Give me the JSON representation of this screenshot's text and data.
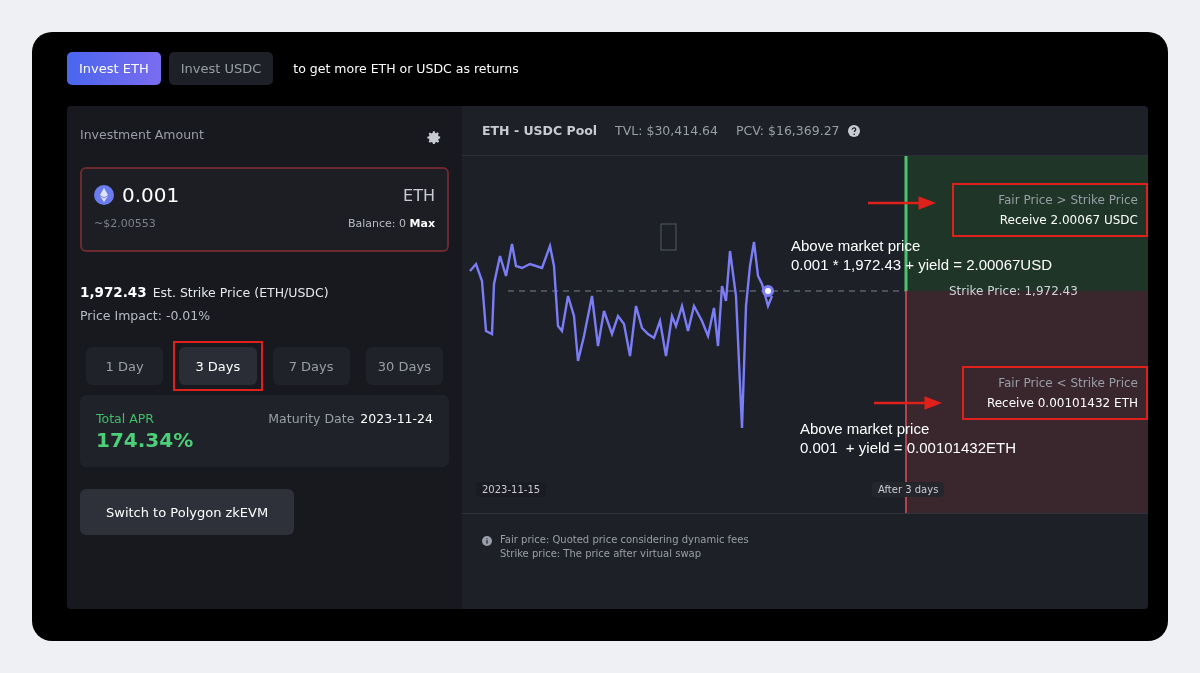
{
  "tabs": [
    {
      "label": "Invest ETH",
      "selected": true
    },
    {
      "label": "Invest USDC",
      "selected": false
    }
  ],
  "tagline": "to get more ETH or USDC as returns",
  "investment": {
    "label": "Investment Amount",
    "amount": "0.001",
    "unit": "ETH",
    "usd": "~$2.00553",
    "balance": "Balance: 0",
    "max": "Max"
  },
  "strike": {
    "value": "1,972.43",
    "label": "Est. Strike Price (ETH/USDC)",
    "impact": "Price Impact: -0.01%"
  },
  "durations": [
    {
      "label": "1 Day",
      "selected": false,
      "annotated": false
    },
    {
      "label": "3 Days",
      "selected": true,
      "annotated": true
    },
    {
      "label": "7 Days",
      "selected": false,
      "annotated": false
    },
    {
      "label": "30 Days",
      "selected": false,
      "annotated": false
    }
  ],
  "apr": {
    "label": "Total APR",
    "value": "174.34%",
    "maturity_label": "Maturity Date",
    "maturity": "2023-11-24"
  },
  "switch_button": "Switch to Polygon zkEVM",
  "pool": {
    "name": "ETH - USDC Pool",
    "tvl": "TVL: $30,414.64",
    "pcv": "PCV: $16,369.27"
  },
  "chart": {
    "strike_label": "Strike Price: 1,972.43",
    "start_date": "2023-11-15",
    "end_label": "After 3 days",
    "outcomes": [
      {
        "kind": "above",
        "condition": "Fair Price > Strike Price",
        "receive": "Receive 2.00067 USDC",
        "annotated": true
      },
      {
        "kind": "below",
        "condition": "Fair Price < Strike Price",
        "receive": "Receive 0.00101432 ETH",
        "annotated": true
      }
    ],
    "notes": [
      {
        "kind": "above",
        "title": "Above market price",
        "formula": "0.001 * 1,972.43 + yield = 2.00067USD"
      },
      {
        "kind": "below",
        "title": "Above market price",
        "formula": "0.001  + yield = 0.00101432ETH"
      }
    ]
  },
  "footnotes": [
    "Fair price: Quoted price considering dynamic fees",
    "Strike price: The price after virtual swap"
  ]
}
